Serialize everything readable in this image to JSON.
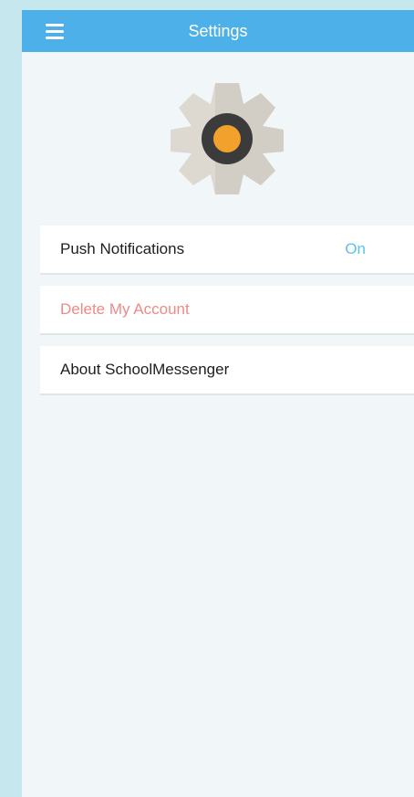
{
  "header": {
    "title": "Settings",
    "menu_icon": "hamburger-menu-icon",
    "background_color": "#4db0e8"
  },
  "hero": {
    "icon": "settings-gear-icon",
    "gear_color": "#ddd9d1",
    "center_color": "#f2a12d"
  },
  "settings": [
    {
      "label": "Push Notifications",
      "value": "On",
      "value_color": "#5cc3e8"
    },
    {
      "label": "Delete My Account",
      "label_color": "#ee8a87"
    },
    {
      "label": "About SchoolMessenger"
    }
  ],
  "colors": {
    "page_background": "#f1f7f8",
    "outer_background": "#c7e7ee",
    "row_background": "#ffffff"
  }
}
